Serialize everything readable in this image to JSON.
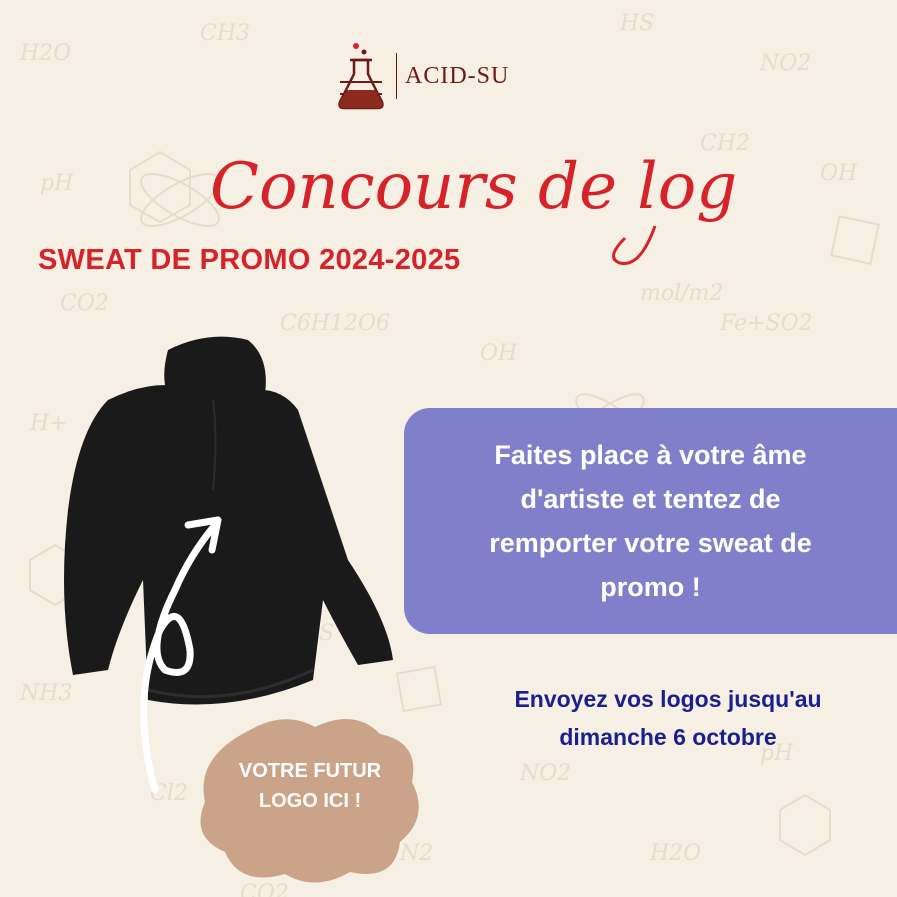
{
  "brand": {
    "name": "ACID-SU",
    "icon": "flask-icon"
  },
  "title": {
    "script": "Concours de logo",
    "subtitle": "SWEAT DE PROMO 2024-2025"
  },
  "info": {
    "lines": [
      "Faites place à votre âme",
      "d'artiste et tentez de",
      "remporter votre sweat de",
      "promo !"
    ]
  },
  "deadline": {
    "lines": [
      "Envoyez vos logos jusqu'au",
      "dimanche 6 octobre"
    ]
  },
  "badge": {
    "lines": [
      "VOTRE FUTUR",
      "LOGO ICI !"
    ]
  },
  "background_formulas": [
    "H2O",
    "CH3",
    "HS",
    "NO2",
    "pH",
    "CH2",
    "OH",
    "CO2",
    "C6H12O6",
    "Fe+SO2",
    "H+",
    "mol/m2",
    "NH3",
    "Cl2",
    "N2"
  ],
  "colors": {
    "background": "#f6efe4",
    "title_red": "#d6232a",
    "brand_maroon": "#6b1a16",
    "info_box": "#7f80c9",
    "deadline_blue": "#1b1f8e",
    "badge": "#caa388",
    "hoodie": "#1a1a1a"
  }
}
